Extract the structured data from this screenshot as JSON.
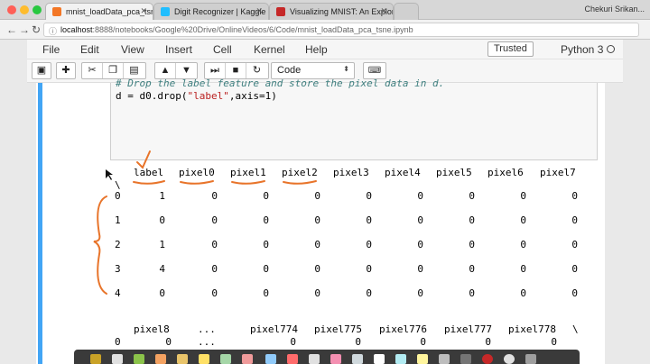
{
  "browser": {
    "tabs": [
      {
        "label": "mnist_loadData_pca_tsne"
      },
      {
        "label": "Digit Recognizer | Kaggle"
      },
      {
        "label": "Visualizing MNIST: An Explor"
      }
    ],
    "user": "Chekuri Srikan...",
    "url_host": "localhost",
    "url_path": ":8888/notebooks/Google%20Drive/OnlineVideos/6/Code/mnist_loadData_pca_tsne.ipynb"
  },
  "menubar": {
    "items": [
      "File",
      "Edit",
      "View",
      "Insert",
      "Cell",
      "Kernel",
      "Help"
    ],
    "trusted": "Trusted",
    "kernel": "Python 3"
  },
  "toolbar": {
    "cell_type": "Code"
  },
  "cell": {
    "comment": "# Drop the label feature and store the pixel data in d.",
    "code_prefix": "d = d0.drop(",
    "code_string": "\"label\"",
    "code_suffix": ",axis=1)"
  },
  "output": {
    "columns": [
      "label",
      "pixel0",
      "pixel1",
      "pixel2",
      "pixel3",
      "pixel4",
      "pixel5",
      "pixel6",
      "pixel7"
    ],
    "continuation": "\\",
    "rows": [
      {
        "index": "0",
        "values": [
          "1",
          "0",
          "0",
          "0",
          "0",
          "0",
          "0",
          "0",
          "0"
        ]
      },
      {
        "index": "1",
        "values": [
          "0",
          "0",
          "0",
          "0",
          "0",
          "0",
          "0",
          "0",
          "0"
        ]
      },
      {
        "index": "2",
        "values": [
          "1",
          "0",
          "0",
          "0",
          "0",
          "0",
          "0",
          "0",
          "0"
        ]
      },
      {
        "index": "3",
        "values": [
          "4",
          "0",
          "0",
          "0",
          "0",
          "0",
          "0",
          "0",
          "0"
        ]
      },
      {
        "index": "4",
        "values": [
          "0",
          "0",
          "0",
          "0",
          "0",
          "0",
          "0",
          "0",
          "0"
        ]
      }
    ],
    "columns2": [
      "pixel8",
      "...",
      "pixel774",
      "pixel775",
      "pixel776",
      "pixel777",
      "pixel778"
    ],
    "continuation2": "\\",
    "row2": {
      "index": "0",
      "values": [
        "0",
        "...",
        "0",
        "0",
        "0",
        "0",
        "0"
      ]
    }
  },
  "colors": {
    "cell_bar": "#42a5f5",
    "annotation": "#e8742a"
  }
}
